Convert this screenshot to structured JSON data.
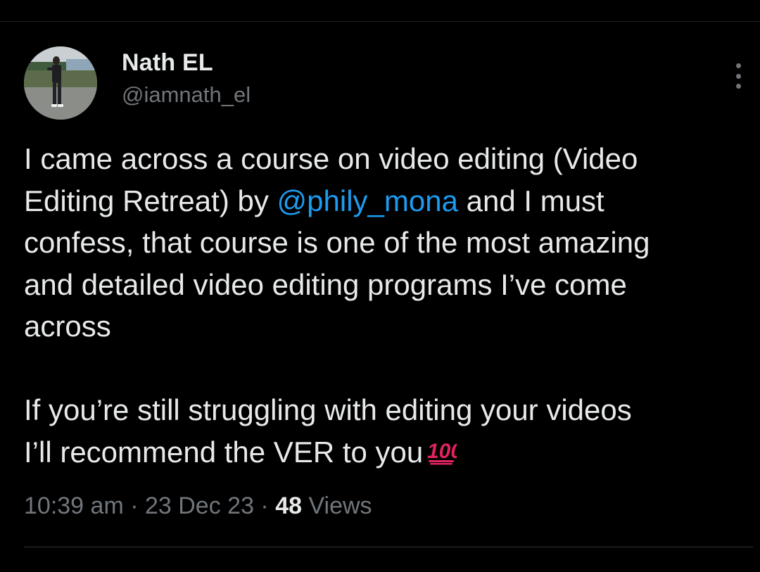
{
  "author": {
    "display_name": "Nath EL",
    "handle": "@iamnath_el",
    "avatar_icon": "profile-photo"
  },
  "menu": {
    "icon": "more-vertical-icon"
  },
  "tweet": {
    "paragraph1": {
      "line1": "I came across a course on video editing (Video",
      "line2_before": "Editing Retreat) by ",
      "mention": "@phily_mona",
      "line2_after": " and I must",
      "line3": "confess, that course is one of the most amazing",
      "line4": "and detailed video editing programs I’ve come",
      "line5": "across"
    },
    "paragraph2": {
      "line1": "If you’re still struggling with editing your videos",
      "line2": "I’ll recommend the VER to you",
      "emoji_icon": "hundred-points-icon"
    }
  },
  "meta": {
    "time": "10:39 am",
    "sep1": " · ",
    "date": "23 Dec 23",
    "sep2": " · ",
    "views_count": "48",
    "views_label": " Views"
  },
  "colors": {
    "background": "#000000",
    "text": "#e7e9ea",
    "secondary": "#71767b",
    "accent": "#1d9bf0",
    "emoji": "#e0245e"
  }
}
